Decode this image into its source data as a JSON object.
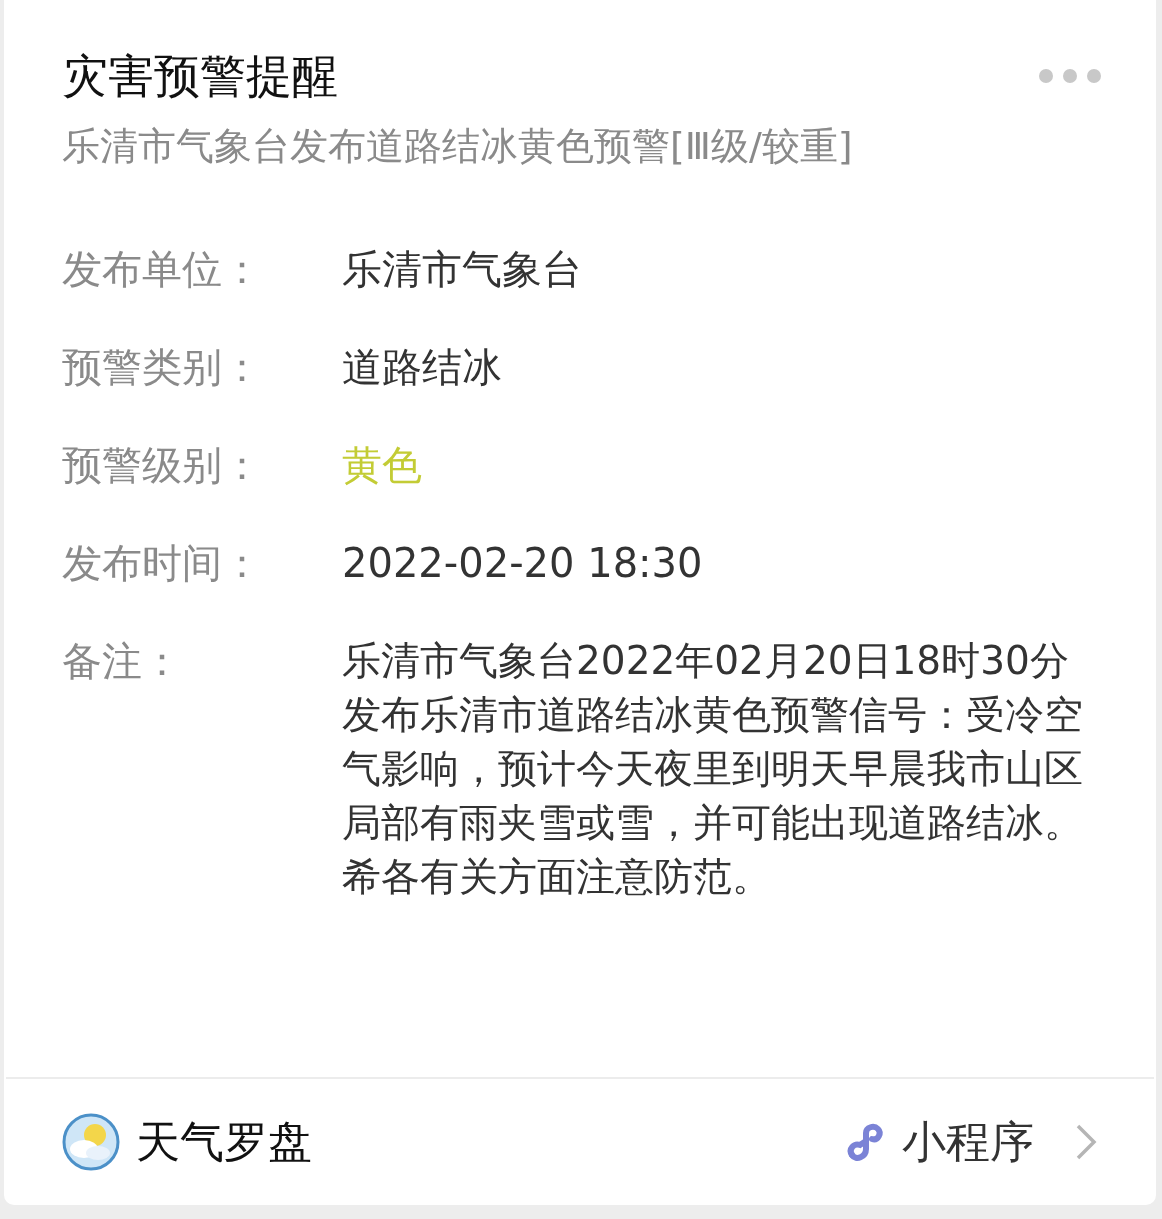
{
  "title": "灾害预警提醒",
  "subtitle": "乐清市气象台发布道路结冰黄色预警[Ⅲ级/较重]",
  "fields": [
    {
      "label": "发布单位：",
      "value": "乐清市气象台",
      "kind": "text"
    },
    {
      "label": "预警类别：",
      "value": "道路结冰",
      "kind": "text"
    },
    {
      "label": "预警级别：",
      "value": "黄色",
      "kind": "level",
      "color": "#c3cc35"
    },
    {
      "label": "发布时间：",
      "value": "2022-02-20 18:30",
      "kind": "text"
    },
    {
      "label": "备注：",
      "value": "乐清市气象台2022年02月20日18时30分发布乐清市道路结冰黄色预警信号：受冷空气影响，预计今天夜里到明天早晨我市山区局部有雨夹雪或雪，并可能出现道路结冰。希各有关方面注意防范。",
      "kind": "paragraph"
    }
  ],
  "footer": {
    "app_name": "天气罗盘",
    "type_label": "小程序"
  }
}
